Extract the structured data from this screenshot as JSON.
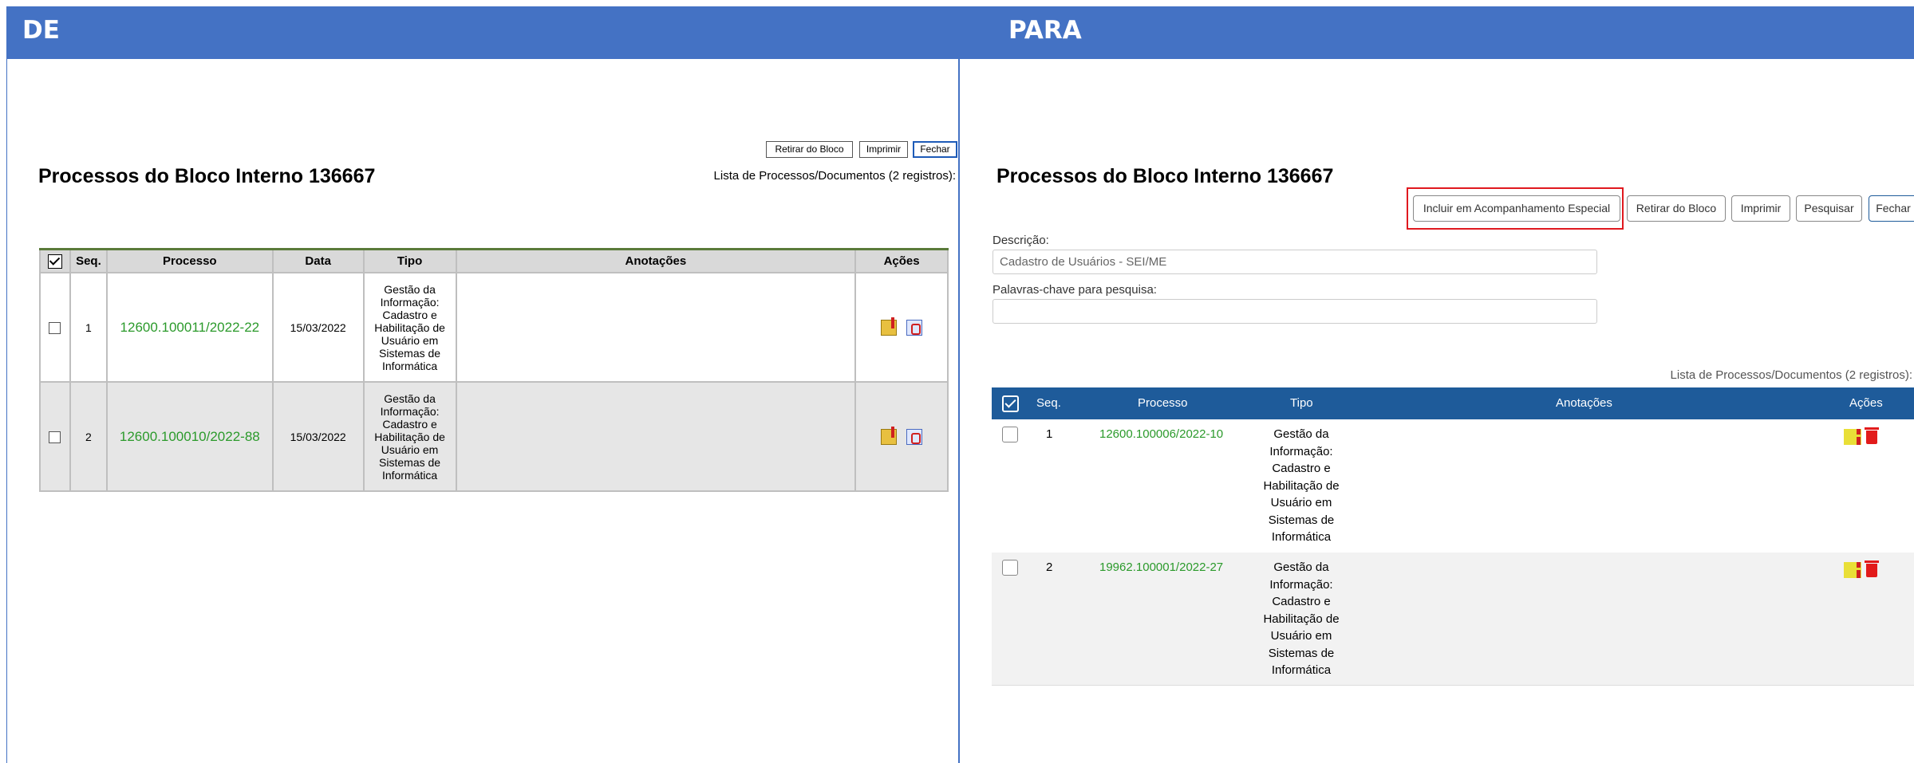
{
  "header": {
    "left_label": "DE",
    "right_label": "PARA"
  },
  "de": {
    "title": "Processos do Bloco Interno 136667",
    "buttons": {
      "retirar": "Retirar do Bloco",
      "imprimir": "Imprimir",
      "fechar": "Fechar"
    },
    "count": "Lista de Processos/Documentos (2 registros):",
    "columns": {
      "seq": "Seq.",
      "processo": "Processo",
      "data": "Data",
      "tipo": "Tipo",
      "anotacoes": "Anotações",
      "acoes": "Ações"
    },
    "rows": [
      {
        "seq": "1",
        "processo": "12600.100011/2022-22",
        "data": "15/03/2022",
        "tipo": [
          "Gestão da",
          "Informação:",
          "Cadastro e",
          "Habilitação de",
          "Usuário em",
          "Sistemas de",
          "Informática"
        ]
      },
      {
        "seq": "2",
        "processo": "12600.100010/2022-88",
        "data": "15/03/2022",
        "tipo": [
          "Gestão da",
          "Informação:",
          "Cadastro e",
          "Habilitação de",
          "Usuário em",
          "Sistemas de",
          "Informática"
        ]
      }
    ]
  },
  "para": {
    "title": "Processos do Bloco Interno 136667",
    "buttons": {
      "incluir": "Incluir em Acompanhamento Especial",
      "retirar": "Retirar do Bloco",
      "imprimir": "Imprimir",
      "pesquisar": "Pesquisar",
      "fechar": "Fechar"
    },
    "descricao_label": "Descrição:",
    "descricao_value": "Cadastro de Usuários - SEI/ME",
    "palavras_label": "Palavras-chave para pesquisa:",
    "palavras_value": "",
    "count": "Lista de Processos/Documentos (2 registros):",
    "columns": {
      "seq": "Seq.",
      "processo": "Processo",
      "tipo": "Tipo",
      "anotacoes": "Anotações",
      "acoes": "Ações"
    },
    "rows": [
      {
        "seq": "1",
        "processo": "12600.100006/2022-10",
        "tipo": [
          "Gestão da",
          "Informação:",
          "Cadastro e",
          "Habilitação de",
          "Usuário em",
          "Sistemas de",
          "Informática"
        ]
      },
      {
        "seq": "2",
        "processo": "19962.100001/2022-27",
        "tipo": [
          "Gestão da",
          "Informação:",
          "Cadastro e",
          "Habilitação de",
          "Usuário em",
          "Sistemas de",
          "Informática"
        ]
      }
    ]
  },
  "colors": {
    "header_bg": "#4472c4",
    "table_header_new": "#1e5b9a",
    "process_link": "#2b9a2b",
    "highlight_box": "#e0191f"
  }
}
